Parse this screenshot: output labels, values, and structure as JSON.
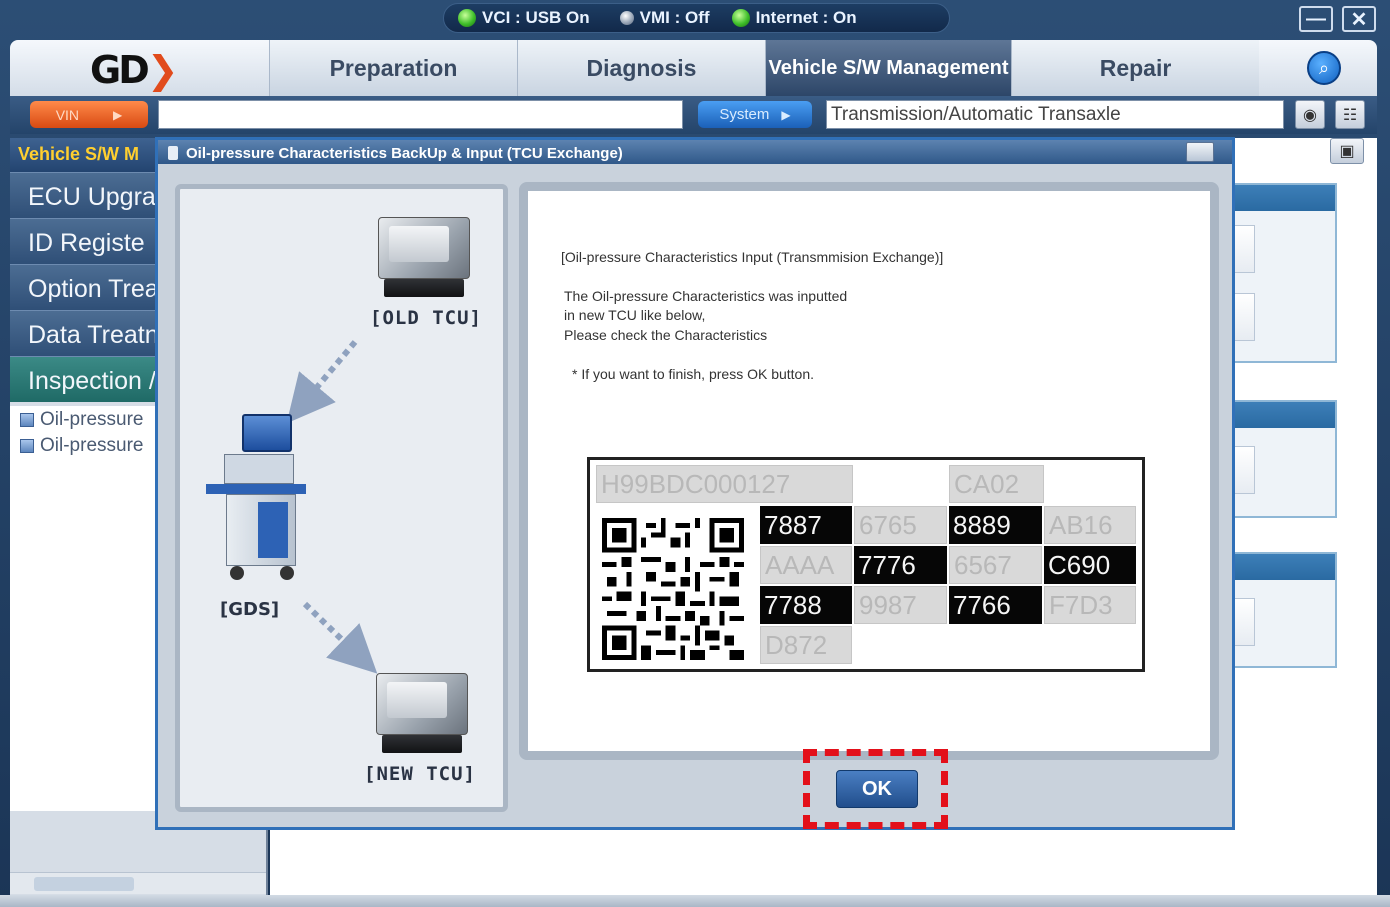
{
  "status": {
    "vci": "VCI : USB On",
    "vmi": "VMI : Off",
    "internet": "Internet : On"
  },
  "window": {
    "minimize": "—",
    "close": "✕"
  },
  "logo": "GD",
  "menu": {
    "preparation": "Preparation",
    "diagnosis": "Diagnosis",
    "vehicle_sw": "Vehicle S/W Management",
    "repair": "Repair"
  },
  "toolbar": {
    "vin_label": "VIN",
    "vin_value": "",
    "system_label": "System",
    "system_value": "Transmission/Automatic Transaxle"
  },
  "sidebar": {
    "title": "Vehicle S/W M",
    "items": [
      {
        "label": "ECU Upgra"
      },
      {
        "label": "ID Registe"
      },
      {
        "label": "Option Treat"
      },
      {
        "label": "Data Treatn"
      },
      {
        "label": "Inspection /"
      }
    ],
    "tree": [
      {
        "label": "Oil-pressure"
      },
      {
        "label": "Oil-pressure"
      }
    ]
  },
  "dialog": {
    "title": "Oil-pressure Characteristics BackUp & Input (TCU Exchange)",
    "old_tcu": "[OLD TCU]",
    "gds": "[GDS]",
    "new_tcu": "[NEW TCU]",
    "heading": "[Oil-pressure Characteristics Input (Transmmision Exchange)]",
    "message": [
      "The Oil-pressure Characteristics was inputted",
      "in new TCU like below,",
      "Please check the Characteristics"
    ],
    "note": "* If you want to finish, press OK button.",
    "code": {
      "serial": "H99BDC000127",
      "version": "CA02",
      "grid": [
        [
          "7887",
          "6765",
          "8889",
          "AB16"
        ],
        [
          "AAAA",
          "7776",
          "6567",
          "C690"
        ],
        [
          "7788",
          "9987",
          "7766",
          "F7D3"
        ],
        [
          "D872"
        ]
      ]
    },
    "ok_label": "OK"
  }
}
